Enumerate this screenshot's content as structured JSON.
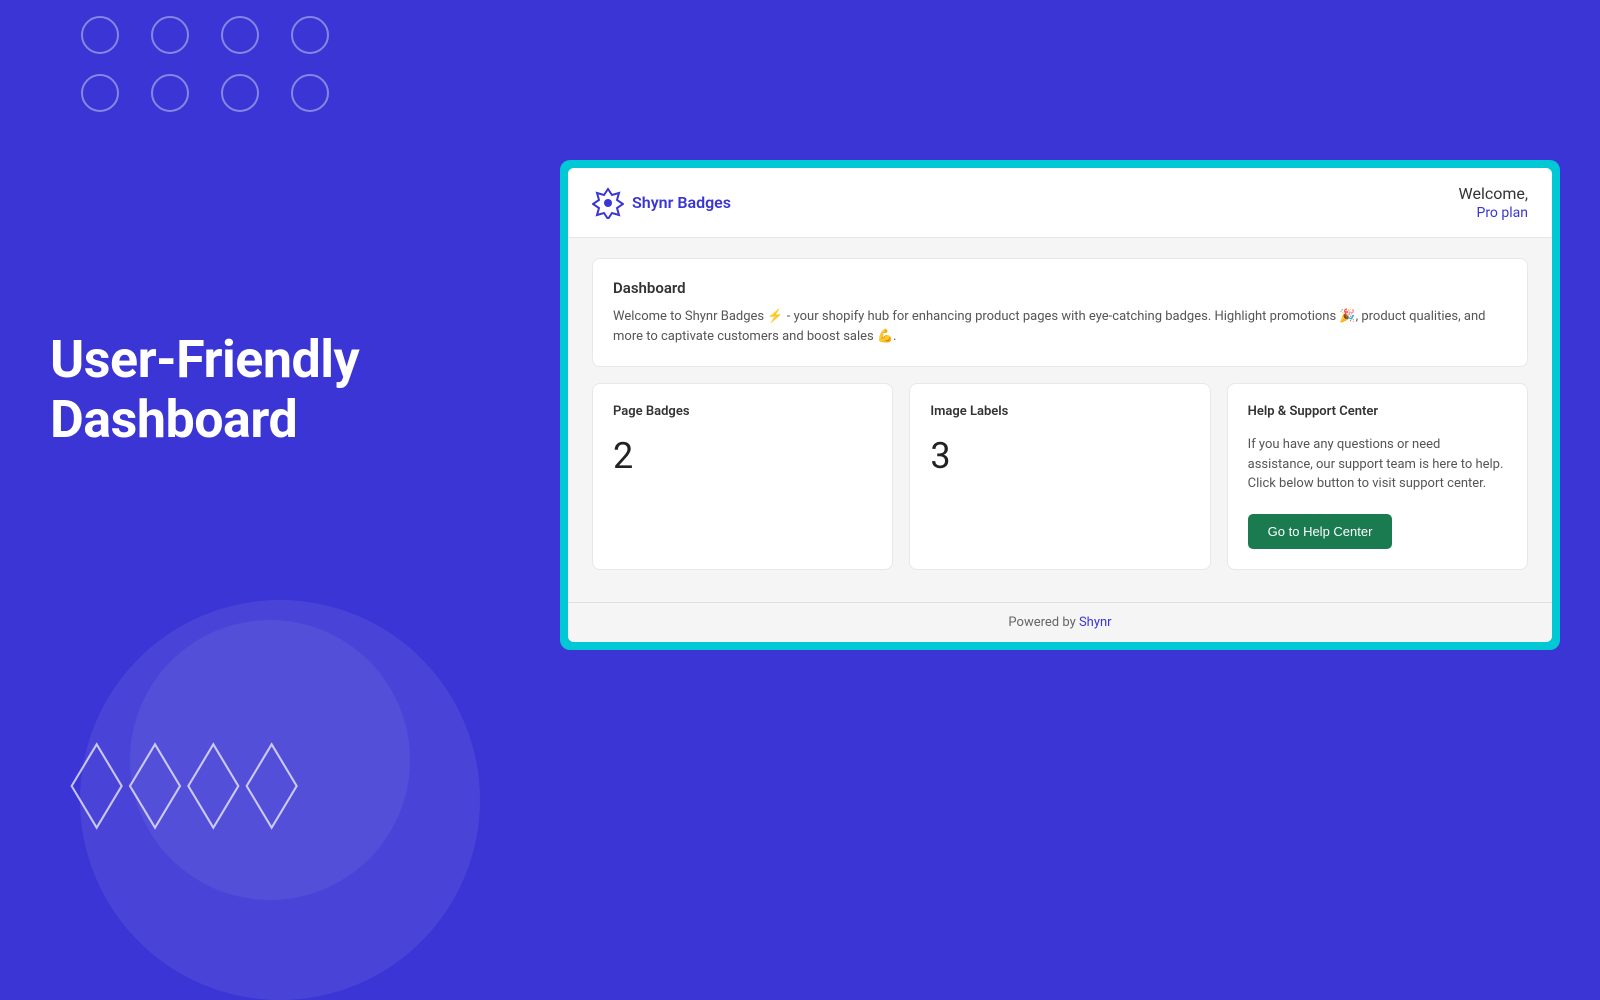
{
  "background": {
    "color": "#3a35d4"
  },
  "left": {
    "heading_line1": "User-Friendly",
    "heading_line2": "Dashboard"
  },
  "header": {
    "logo_text": "Shynr Badges",
    "welcome_text": "Welcome,",
    "pro_plan_label": "Pro plan"
  },
  "dashboard": {
    "title": "Dashboard",
    "description": "Welcome to Shynr Badges ⚡ - your shopify hub for enhancing product pages with eye-catching badges. Highlight promotions 🎉, product qualities, and more to captivate customers and boost sales 💪."
  },
  "cards": {
    "page_badges": {
      "title": "Page Badges",
      "count": "2"
    },
    "image_labels": {
      "title": "Image Labels",
      "count": "3"
    },
    "support": {
      "title": "Help & Support Center",
      "description": "If you have any questions or need assistance, our support team is here to help. Click below button to visit support center.",
      "button_label": "Go to Help Center"
    }
  },
  "footer": {
    "powered_by_text": "Powered by",
    "powered_by_link": "Shynr"
  }
}
